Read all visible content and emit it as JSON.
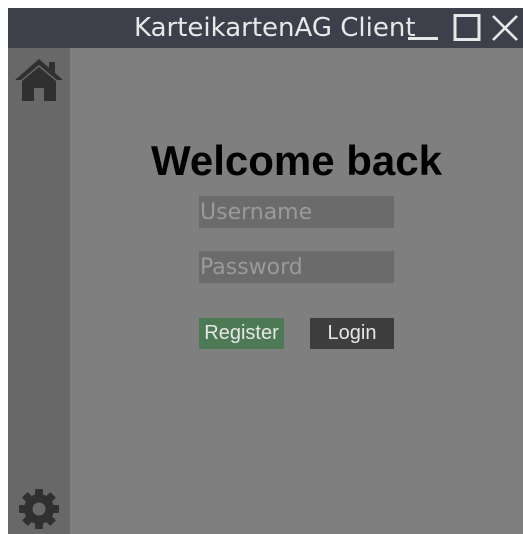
{
  "window": {
    "title": "KarteikartenAG Client",
    "controls": {
      "minimize_icon": "minimize-icon",
      "maximize_icon": "maximize-icon",
      "close_icon": "close-icon"
    }
  },
  "sidebar": {
    "items": [
      {
        "icon": "home-icon"
      },
      {
        "icon": "gear-icon"
      }
    ]
  },
  "login": {
    "heading": "Welcome back",
    "username": {
      "value": "",
      "placeholder": "Username"
    },
    "password": {
      "value": "",
      "placeholder": "Password"
    },
    "register_label": "Register",
    "login_label": "Login"
  },
  "colors": {
    "titlebar": "#3d3f4a",
    "background": "#7f7f7f",
    "sidebar": "#686868",
    "input": "#6b6b6b",
    "register_button": "#4d7a55",
    "login_button": "#3e3e3e"
  }
}
